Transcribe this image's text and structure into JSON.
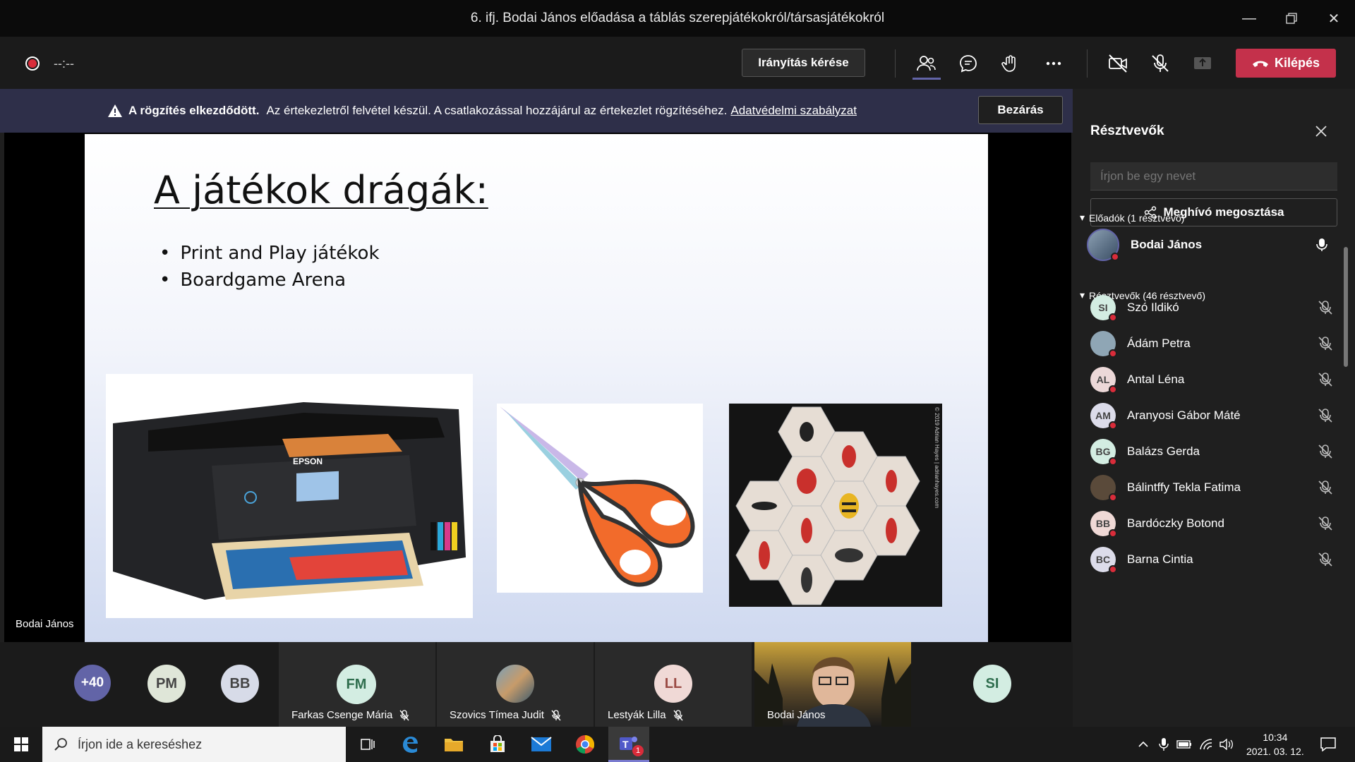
{
  "window": {
    "title": "6. ifj. Bodai János előadása a táblás szerepjátékokról/társasjátékokról"
  },
  "toolbar": {
    "timer": "--:--",
    "control_label": "Irányítás kérése",
    "leave_label": "Kilépés"
  },
  "banner": {
    "bold_text": "A rögzítés elkezdődött.",
    "text": "Az értekezletről felvétel készül. A csatlakozással hozzájárul az értekezlet rögzítéséhez.",
    "link": "Adatvédelmi szabályzat",
    "close_label": "Bezárás"
  },
  "slide": {
    "title": "A játékok drágák:",
    "bullets": [
      "Print and Play játékok",
      "Boardgame Arena"
    ],
    "printer_brand": "EPSON",
    "scissors": "scissors",
    "tiles_caption": "© 2019 Adrian Hayes | adrianhayes.com"
  },
  "stage": {
    "speaker_name": "Bodai János"
  },
  "bottom_tiles": {
    "overflow": "+40",
    "pm": "PM",
    "bb": "BB",
    "farkas": {
      "initials": "FM",
      "name": "Farkas Csenge Mária"
    },
    "szovics": {
      "name": "Szovics Tímea Judit"
    },
    "lestyak": {
      "initials": "LL",
      "name": "Lestyák Lilla"
    },
    "bodai": {
      "name": "Bodai János"
    },
    "si": "SI"
  },
  "participants_panel": {
    "title": "Résztvevők",
    "search_placeholder": "Írjon be egy nevet",
    "share_label": "Meghívó megosztása",
    "presenters_header": "Előadók (1 résztvevő)",
    "attendees_header": "Résztvevők (46 résztvevő)",
    "presenter": {
      "name": "Bodai János"
    },
    "attendees": [
      {
        "initials": "SI",
        "name": "Szó Ildikó",
        "color": "#d3ede2"
      },
      {
        "initials": "",
        "name": "Ádám Petra",
        "color": "#8fa6b5"
      },
      {
        "initials": "AL",
        "name": "Antal Léna",
        "color": "#ecd8d8"
      },
      {
        "initials": "AM",
        "name": "Aranyosi Gábor Máté",
        "color": "#dcdcea"
      },
      {
        "initials": "BG",
        "name": "Balázs Gerda",
        "color": "#d3ede2"
      },
      {
        "initials": "",
        "name": "Bálintffy Tekla Fatima",
        "color": "#5a4a3a"
      },
      {
        "initials": "BB",
        "name": "Bardóczky Botond",
        "color": "#f0d9d6"
      },
      {
        "initials": "BC",
        "name": "Barna Cintia",
        "color": "#dcdcea"
      }
    ]
  },
  "taskbar": {
    "search_placeholder": "Írjon ide a kereséshez",
    "time": "10:34",
    "date": "2021. 03. 12.",
    "teams_badge": "1"
  },
  "colors": {
    "accent_purple": "#6264a7",
    "leave_red": "#c4314b",
    "banner_bg": "#2e2f49"
  }
}
